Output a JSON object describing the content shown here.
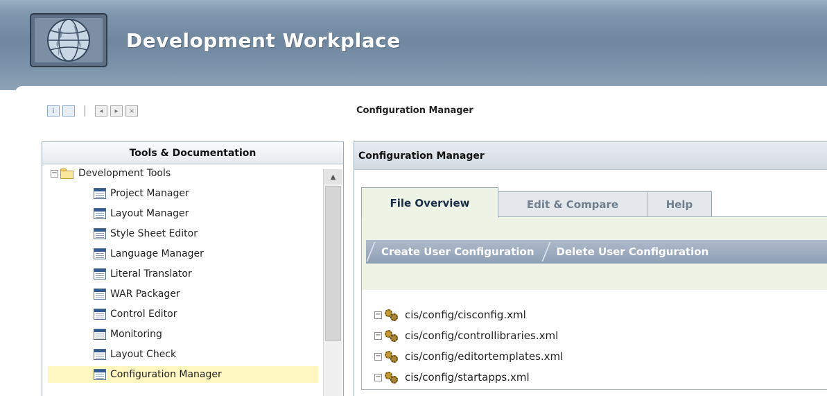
{
  "header": {
    "title": "Development Workplace",
    "logo_icon": "globe-logo-icon"
  },
  "toolbar": {
    "buttons": [
      {
        "icon": "info-icon",
        "glyph": "i"
      },
      {
        "icon": "window-icon",
        "glyph": ""
      },
      {
        "icon": "previous-icon",
        "glyph": "◂"
      },
      {
        "icon": "next-icon",
        "glyph": "▸"
      },
      {
        "icon": "close-icon",
        "glyph": "×"
      }
    ]
  },
  "page_heading": "Configuration Manager",
  "left_panel": {
    "title": "Tools & Documentation",
    "tree": {
      "root_label": "Development Tools",
      "root_collapse_glyph": "−",
      "items": [
        "Project Manager",
        "Layout Manager",
        "Style Sheet Editor",
        "Language Manager",
        "Literal Translator",
        "WAR Packager",
        "Control Editor",
        "Monitoring",
        "Layout Check",
        "Configuration Manager"
      ],
      "selected_item": "Configuration Manager"
    },
    "scroll_up_glyph": "▲"
  },
  "right_panel": {
    "title": "Configuration Manager",
    "tabs": [
      "File Overview",
      "Edit & Compare",
      "Help"
    ],
    "active_tab": "File Overview",
    "actions": [
      "Create User Configuration",
      "Delete User Configuration"
    ],
    "files": [
      "cis/config/cisconfig.xml",
      "cis/config/controllibraries.xml",
      "cis/config/editortemplates.xml",
      "cis/config/startapps.xml"
    ],
    "file_collapse_glyph": "−"
  },
  "colors": {
    "header": "#7e97ad",
    "selected_row": "#fff6c0",
    "active_tab": "#edf4e6",
    "action_bar": "#9aa9bc"
  }
}
